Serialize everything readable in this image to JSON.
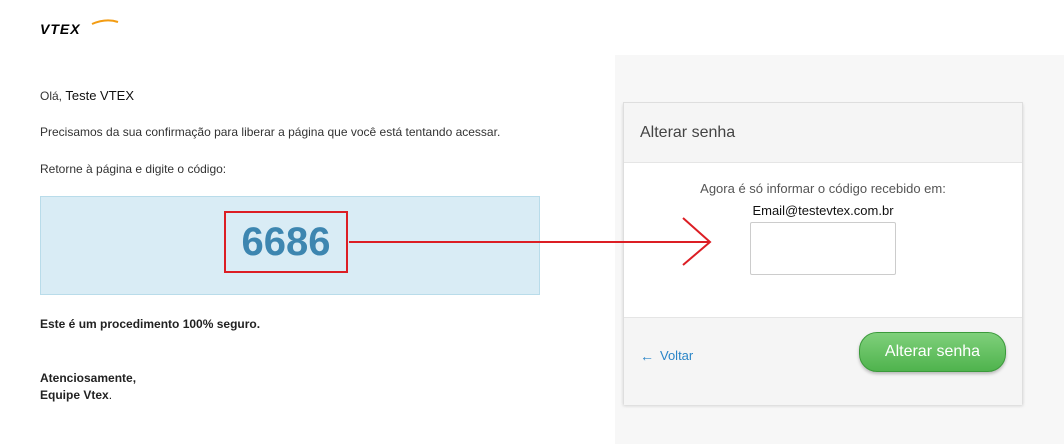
{
  "brand": {
    "logo_text": "VTEX"
  },
  "email_message": {
    "greeting_prefix": "Olá,",
    "greeting_name": "Teste VTEX",
    "paragraph_confirmation": "Precisamos da sua confirmação para liberar a página que você está tentando acessar.",
    "paragraph_instruction": "Retorne à página e digite o código:",
    "code": "6686",
    "secure_note": "Este é um procedimento 100% seguro.",
    "closing": "Atenciosamente,",
    "signature": "Equipe Vtex",
    "signature_dot": "."
  },
  "modal": {
    "title": "Alterar senha",
    "info_text": "Agora é só informar o código recebido em:",
    "email": "Email@testevtex.com.br",
    "code_input_value": "",
    "back_label": "Voltar",
    "submit_label": "Alterar senha"
  },
  "colors": {
    "highlight_red": "#dc1e24",
    "code_blue": "#3d86b0",
    "submit_green": "#5cb85c",
    "link_blue": "#2a85c7"
  }
}
